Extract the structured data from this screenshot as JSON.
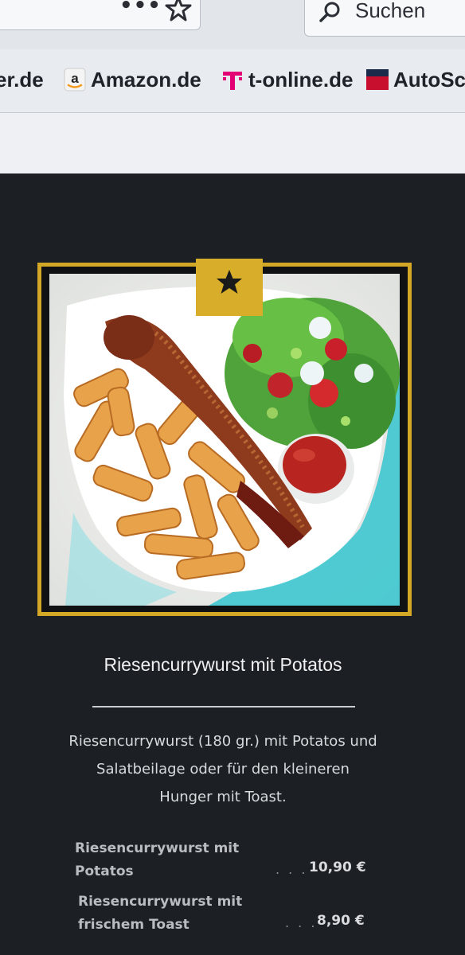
{
  "browser": {
    "overflow_icon": "more-dots-icon",
    "bookmark_star_icon": "star-outline-icon",
    "search_placeholder": "Suchen",
    "bookmarks": [
      {
        "label": "er.de",
        "icon": "none"
      },
      {
        "label": "Amazon.de",
        "icon": "amazon-logo-icon"
      },
      {
        "label": "t-online.de",
        "icon": "telekom-t-icon"
      },
      {
        "label": "AutoSc",
        "icon": "autoscout-logo-icon"
      }
    ]
  },
  "product": {
    "badge_icon": "star-icon",
    "title": "Riesencurrywurst mit Potatos",
    "description_lines": [
      "Riesencurrywurst (180 gr.) mit Potatos und",
      "Salatbeilage oder für den kleineren",
      "Hunger mit Toast."
    ],
    "prices": [
      {
        "name_lines": [
          "Riesencurrywurst mit",
          "Potatos"
        ],
        "dots": ". . .",
        "price": "10,90 €"
      },
      {
        "name_lines": [
          "Riesencurrywurst mit",
          "frischem Toast"
        ],
        "dots": ". . .",
        "price": "8,90 €"
      }
    ]
  },
  "colors": {
    "accent_gold": "#d3a827",
    "page_background": "#1c2024",
    "telekom_magenta": "#e20074"
  }
}
